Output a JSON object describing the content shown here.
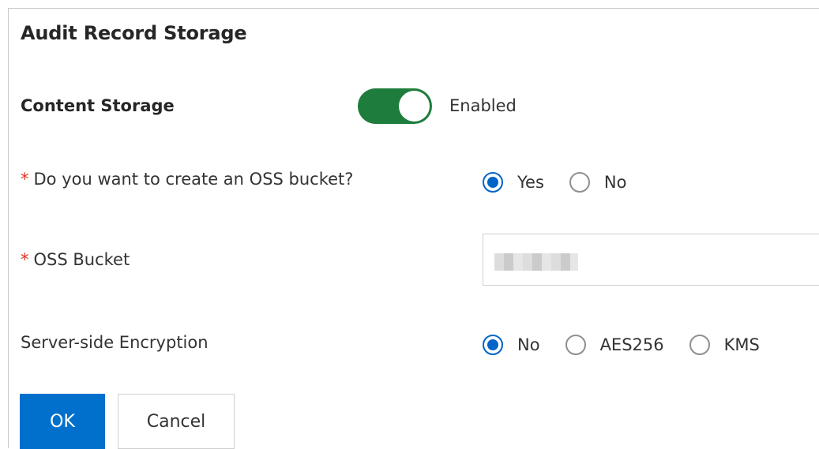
{
  "dialog": {
    "title": "Audit Record Storage"
  },
  "content_storage": {
    "label": "Content Storage",
    "switch_state": "Enabled"
  },
  "create_bucket": {
    "required_mark": "*",
    "label": "Do you want to create an OSS bucket?",
    "options": [
      "Yes",
      "No"
    ],
    "selected": "Yes"
  },
  "oss_bucket": {
    "required_mark": "*",
    "label": "OSS Bucket",
    "value": ""
  },
  "encryption": {
    "label": "Server-side Encryption",
    "options": [
      "No",
      "AES256",
      "KMS"
    ],
    "selected": "No"
  },
  "actions": {
    "ok_label": "OK",
    "cancel_label": "Cancel"
  },
  "colors": {
    "switch_on": "#1e7d3c",
    "primary": "#0070cc",
    "radio_checked": "#0064c8",
    "required": "#e0301e"
  }
}
